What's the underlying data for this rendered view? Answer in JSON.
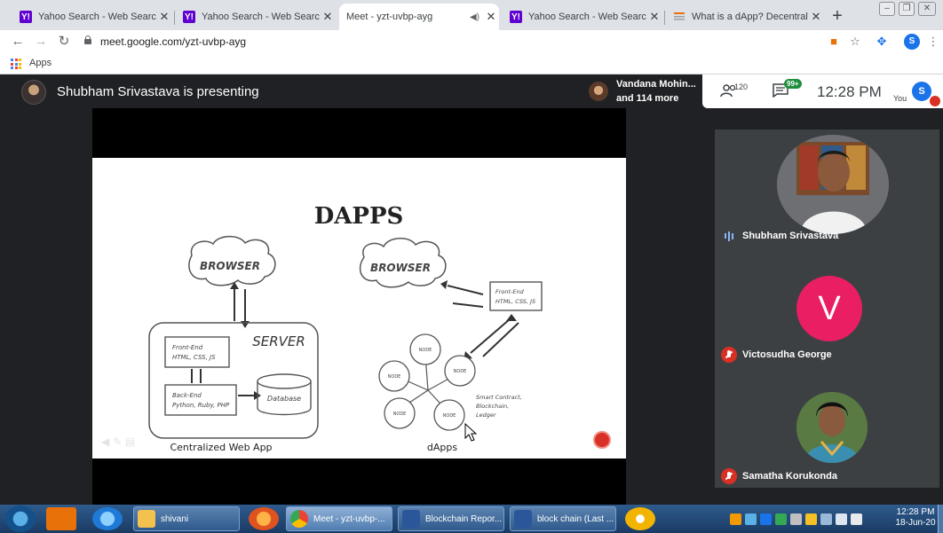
{
  "browser": {
    "tabs": [
      {
        "title": "Yahoo Search - Web Search",
        "favicon": "yahoo-icon",
        "active": false
      },
      {
        "title": "Yahoo Search - Web Search",
        "favicon": "yahoo-icon",
        "active": false
      },
      {
        "title": "Meet - yzt-uvbp-ayg",
        "favicon": "meet-icon",
        "active": true
      },
      {
        "title": "Yahoo Search - Web Search",
        "favicon": "yahoo-icon",
        "active": false
      },
      {
        "title": "What is a dApp? Decentralized",
        "favicon": "document-icon",
        "active": false
      }
    ],
    "new_tab": "+",
    "url": "meet.google.com/yzt-uvbp-ayg",
    "profile_initial": "S",
    "bookmarks": {
      "apps_label": "Apps"
    },
    "accent": "#1a73e8"
  },
  "meet": {
    "presenting_text": "Shubham Srivastava is presenting",
    "viewer_name": "Vandana Mohin...",
    "viewer_more": "and 114 more",
    "participant_count": "120",
    "chat_badge": "99+",
    "clock": "12:28 PM",
    "you_label": "You",
    "you_initial": "S",
    "slide": {
      "title": "DAPPS",
      "left_caption": "Centralized Web App",
      "right_caption": "dApps",
      "browser_label": "BROWSER",
      "server_label": "SERVER",
      "frontend_line1": "Front-End",
      "frontend_line2": "HTML, CSS, JS",
      "backend_line1": "Back-End",
      "backend_line2": "Python, Ruby, PHP",
      "database_label": "Database",
      "node_label": "NODE",
      "smart_line1": "Smart Contract,",
      "smart_line2": "Blockchain,",
      "smart_line3": "Ledger"
    },
    "participants": [
      {
        "name": "Shubham Srivastava",
        "muted": false,
        "speaking": true
      },
      {
        "name": "Victosudha George",
        "muted": true,
        "initial": "V",
        "color": "#e91e63"
      },
      {
        "name": "Samatha Korukonda",
        "muted": true
      }
    ]
  },
  "taskbar": {
    "tasks": [
      {
        "label": "shivani",
        "icon": "folder-icon"
      },
      {
        "label": "Meet - yzt-uvbp-...",
        "icon": "chrome-icon",
        "active": true
      },
      {
        "label": "Blockchain Repor...",
        "icon": "word-icon"
      },
      {
        "label": "block chain (Last ...",
        "icon": "word-icon"
      }
    ],
    "time": "12:28 PM",
    "date": "18-Jun-20"
  }
}
